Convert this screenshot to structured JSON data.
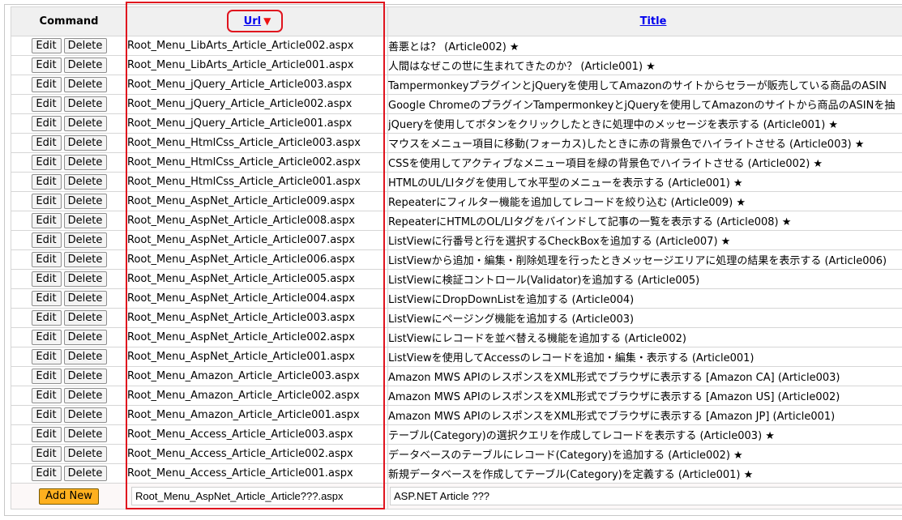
{
  "header": {
    "command": "Command",
    "url": "Url",
    "title": "Title",
    "sort_icon": "▼"
  },
  "buttons": {
    "edit": "Edit",
    "delete": "Delete",
    "add_new": "Add New"
  },
  "colors": {
    "highlight": "#e0141e",
    "add_new_bg": "#ffb01f",
    "link": "#0000ee"
  },
  "rows": [
    {
      "url": "Root_Menu_LibArts_Article_Article002.aspx",
      "title": "善悪とは？ (Article002) ★"
    },
    {
      "url": "Root_Menu_LibArts_Article_Article001.aspx",
      "title": "人間はなぜこの世に生まれてきたのか？ (Article001) ★"
    },
    {
      "url": "Root_Menu_jQuery_Article_Article003.aspx",
      "title": "TampermonkeyプラグインとjQueryを使用してAmazonのサイトからセラーが販売している商品のASIN"
    },
    {
      "url": "Root_Menu_jQuery_Article_Article002.aspx",
      "title": "Google ChromeのプラグインTampermonkeyとjQueryを使用してAmazonのサイトから商品のASINを抽"
    },
    {
      "url": "Root_Menu_jQuery_Article_Article001.aspx",
      "title": "jQueryを使用してボタンをクリックしたときに処理中のメッセージを表示する (Article001) ★"
    },
    {
      "url": "Root_Menu_HtmlCss_Article_Article003.aspx",
      "title": "マウスをメニュー項目に移動(フォーカス)したときに赤の背景色でハイライトさせる (Article003) ★"
    },
    {
      "url": "Root_Menu_HtmlCss_Article_Article002.aspx",
      "title": "CSSを使用してアクティブなメニュー項目を緑の背景色でハイライトさせる (Article002) ★"
    },
    {
      "url": "Root_Menu_HtmlCss_Article_Article001.aspx",
      "title": "HTMLのUL/LIタグを使用して水平型のメニューを表示する (Article001) ★"
    },
    {
      "url": "Root_Menu_AspNet_Article_Article009.aspx",
      "title": "Repeaterにフィルター機能を追加してレコードを絞り込む (Article009) ★"
    },
    {
      "url": "Root_Menu_AspNet_Article_Article008.aspx",
      "title": "RepeaterにHTMLのOL/LIタグをバインドして記事の一覧を表示する (Article008) ★"
    },
    {
      "url": "Root_Menu_AspNet_Article_Article007.aspx",
      "title": "ListViewに行番号と行を選択するCheckBoxを追加する (Article007) ★"
    },
    {
      "url": "Root_Menu_AspNet_Article_Article006.aspx",
      "title": "ListViewから追加・編集・削除処理を行ったときメッセージエリアに処理の結果を表示する (Article006)"
    },
    {
      "url": "Root_Menu_AspNet_Article_Article005.aspx",
      "title": "ListViewに検証コントロール(Validator)を追加する (Article005)"
    },
    {
      "url": "Root_Menu_AspNet_Article_Article004.aspx",
      "title": "ListViewにDropDownListを追加する (Article004)"
    },
    {
      "url": "Root_Menu_AspNet_Article_Article003.aspx",
      "title": "ListViewにページング機能を追加する (Article003)"
    },
    {
      "url": "Root_Menu_AspNet_Article_Article002.aspx",
      "title": "ListViewにレコードを並べ替える機能を追加する (Article002)"
    },
    {
      "url": "Root_Menu_AspNet_Article_Article001.aspx",
      "title": "ListViewを使用してAccessのレコードを追加・編集・表示する (Article001)"
    },
    {
      "url": "Root_Menu_Amazon_Article_Article003.aspx",
      "title": "Amazon MWS APIのレスポンスをXML形式でブラウザに表示する [Amazon CA] (Article003)"
    },
    {
      "url": "Root_Menu_Amazon_Article_Article002.aspx",
      "title": "Amazon MWS APIのレスポンスをXML形式でブラウザに表示する [Amazon US] (Article002)"
    },
    {
      "url": "Root_Menu_Amazon_Article_Article001.aspx",
      "title": "Amazon MWS APIのレスポンスをXML形式でブラウザに表示する [Amazon JP] (Article001)"
    },
    {
      "url": "Root_Menu_Access_Article_Article003.aspx",
      "title": "テーブル(Category)の選択クエリを作成してレコードを表示する (Article003) ★"
    },
    {
      "url": "Root_Menu_Access_Article_Article002.aspx",
      "title": "データベースのテーブルにレコード(Category)を追加する (Article002) ★"
    },
    {
      "url": "Root_Menu_Access_Article_Article001.aspx",
      "title": "新規データベースを作成してテーブル(Category)を定義する (Article001) ★"
    }
  ],
  "new_row": {
    "url_value": "Root_Menu_AspNet_Article_Article???.aspx",
    "title_value": "ASP.NET Article ???"
  }
}
